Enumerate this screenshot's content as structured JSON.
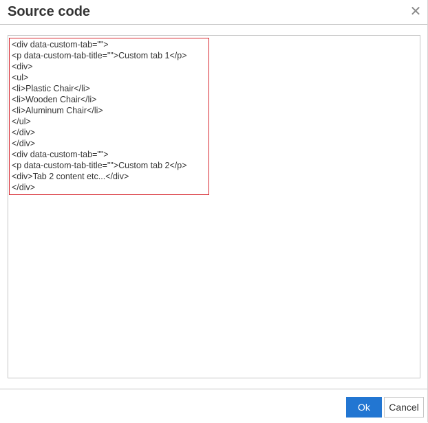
{
  "dialog": {
    "title": "Source code",
    "close_icon": "close-icon"
  },
  "editor": {
    "content": "<div data-custom-tab=\"\">\n<p data-custom-tab-title=\"\">Custom tab 1</p>\n<div>\n<ul>\n<li>Plastic Chair</li>\n<li>Wooden Chair</li>\n<li>Aluminum Chair</li>\n</ul>\n</div>\n</div>\n<div data-custom-tab=\"\">\n<p data-custom-tab-title=\"\">Custom tab 2</p>\n<div>Tab 2 content etc...</div>\n</div>",
    "highlight_color": "#d7262e"
  },
  "footer": {
    "ok_label": "Ok",
    "cancel_label": "Cancel",
    "ok_color": "#2276d2"
  }
}
